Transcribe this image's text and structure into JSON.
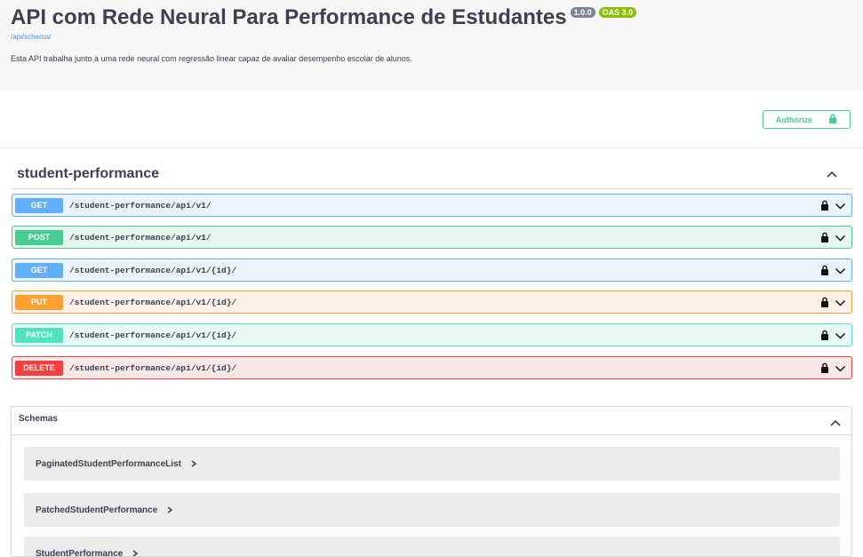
{
  "info": {
    "title": "API com Rede Neural Para Performance de Estudantes",
    "version_badge": "1.0.0",
    "oas_badge": "OAS 3.0",
    "schema_link": "/api/schema/",
    "description": "Esta API trabalha junto à uma rede neural com regressão linear capaz de avaliar desempenho escolar de alunos."
  },
  "authorize": {
    "label": "Authorize"
  },
  "tag": {
    "name": "student-performance"
  },
  "operations": [
    {
      "method": "GET",
      "path": "/student-performance/api/v1/"
    },
    {
      "method": "POST",
      "path": "/student-performance/api/v1/"
    },
    {
      "method": "GET",
      "path": "/student-performance/api/v1/{id}/"
    },
    {
      "method": "PUT",
      "path": "/student-performance/api/v1/{id}/"
    },
    {
      "method": "PATCH",
      "path": "/student-performance/api/v1/{id}/"
    },
    {
      "method": "DELETE",
      "path": "/student-performance/api/v1/{id}/"
    }
  ],
  "schemas": {
    "title": "Schemas",
    "models": [
      {
        "name": "PaginatedStudentPerformanceList"
      },
      {
        "name": "PatchedStudentPerformance"
      },
      {
        "name": "StudentPerformance"
      }
    ]
  },
  "colors": {
    "get": "#61affe",
    "post": "#49cc90",
    "put": "#fca130",
    "patch": "#50e3c2",
    "delete": "#f93e3e",
    "link": "#4990e2",
    "text": "#3b4151"
  },
  "icons": [
    "lock-icon",
    "chevron-down-icon",
    "chevron-up-icon",
    "chevron-right-icon"
  ]
}
